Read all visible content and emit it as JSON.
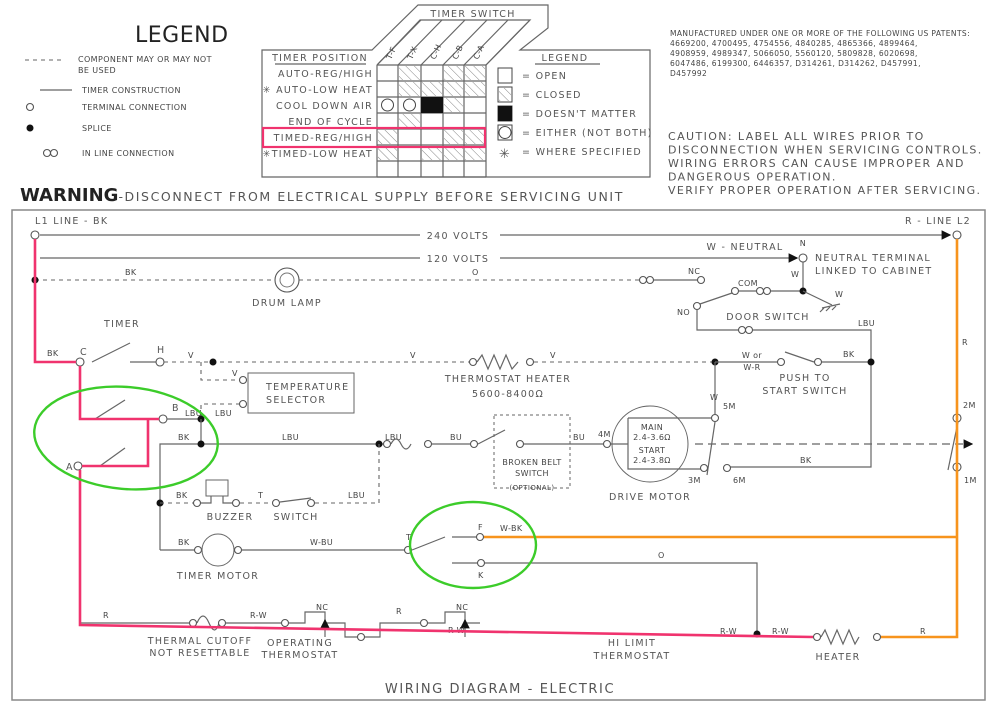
{
  "legend_left": {
    "title": "LEGEND",
    "items": [
      {
        "label": "COMPONENT MAY OR MAY NOT",
        "label2": "BE USED",
        "symbol": "dashed-line"
      },
      {
        "label": "TIMER CONSTRUCTION",
        "symbol": "solid-line"
      },
      {
        "label": "TERMINAL CONNECTION",
        "symbol": "open-circle"
      },
      {
        "label": "SPLICE",
        "symbol": "filled-dot"
      },
      {
        "label": "IN LINE CONNECTION",
        "symbol": "double-circle"
      }
    ]
  },
  "timer_chart": {
    "title": "TIMER SWITCH",
    "position_header": "TIMER POSITION",
    "columns": [
      "T-F",
      "T-X",
      "C-H",
      "C-B",
      "C-A"
    ],
    "rows": [
      {
        "label": "AUTO-REG/HIGH",
        "cells": [
          "open",
          "closed",
          "open",
          "closed",
          "closed"
        ]
      },
      {
        "label": "✳ AUTO-LOW HEAT",
        "cells": [
          "open",
          "closed",
          "closed",
          "closed",
          "closed"
        ]
      },
      {
        "label": "COOL DOWN   AIR",
        "cells": [
          "either",
          "either",
          "doesnt-matter",
          "closed",
          "open"
        ]
      },
      {
        "label": "END OF CYCLE",
        "cells": [
          "open",
          "closed",
          "open",
          "open",
          "open"
        ]
      },
      {
        "label": "TIMED-REG/HIGH",
        "cells": [
          "closed",
          "open",
          "open",
          "closed",
          "closed"
        ],
        "highlighted": true
      },
      {
        "label": "✳TIMED-LOW HEAT",
        "cells": [
          "closed",
          "open",
          "closed",
          "closed",
          "closed"
        ]
      }
    ],
    "legend_title": "LEGEND",
    "legend": [
      {
        "symbol": "open",
        "label": "= OPEN"
      },
      {
        "symbol": "closed",
        "label": "= CLOSED"
      },
      {
        "symbol": "doesnt-matter",
        "label": "= DOESN'T MATTER"
      },
      {
        "symbol": "either",
        "label": "= EITHER (NOT BOTH)"
      },
      {
        "symbol": "asterisk",
        "label": "= WHERE SPECIFIED"
      }
    ]
  },
  "patents": [
    "MANUFACTURED UNDER ONE OR MORE OF THE FOLLOWING US PATENTS:",
    "4669200,  4700495,  4754556,  4840285,  4865366,  4899464,",
    "4908959,  4989347,  5066050,  5560120,  5809828,  6020698,",
    "6047486,  6199300,  6446357,  D314261,  D314262,  D457991,",
    "D457992"
  ],
  "caution": [
    "CAUTION: LABEL ALL WIRES PRIOR TO",
    "DISCONNECTION WHEN SERVICING CONTROLS.",
    "WIRING ERRORS CAN CAUSE IMPROPER AND",
    "DANGEROUS OPERATION.",
    "VERIFY PROPER OPERATION AFTER SERVICING."
  ],
  "warning": {
    "bold": "WARNING",
    "text": "-DISCONNECT FROM ELECTRICAL SUPPLY BEFORE SERVICING UNIT"
  },
  "diagram": {
    "title": "WIRING DIAGRAM - ELECTRIC",
    "l1": "L1 LINE - BK",
    "l2": "R - LINE L2",
    "v240": "240 VOLTS",
    "v120": "120 VOLTS",
    "neutral": "W - NEUTRAL",
    "n": "N",
    "neutral_terminal": [
      "NEUTRAL TERMINAL",
      "LINKED TO CABINET"
    ],
    "drum_lamp": "DRUM LAMP",
    "door_switch": "DOOR SWITCH",
    "timer": "TIMER",
    "temperature_selector": [
      "TEMPERATURE",
      "SELECTOR"
    ],
    "thermostat_heater": [
      "THERMOSTAT HEATER",
      "5600-8400Ω"
    ],
    "push_to_start": [
      "PUSH TO",
      "START SWITCH"
    ],
    "w_or_wr": [
      "W or",
      "W-R"
    ],
    "broken_belt": [
      "BROKEN BELT",
      "SWITCH",
      "(OPTIONAL)"
    ],
    "drive_motor": "DRIVE MOTOR",
    "motor_main": [
      "MAIN",
      "2.4-3.6Ω"
    ],
    "motor_start": [
      "START",
      "2.4-3.8Ω"
    ],
    "buzzer": "BUZZER",
    "switch": "SWITCH",
    "timer_motor": "TIMER MOTOR",
    "thermal_cutoff": [
      "THERMAL CUTOFF",
      "NOT RESETTABLE"
    ],
    "operating_thermostat": [
      "OPERATING",
      "THERMOSTAT"
    ],
    "hi_limit": [
      "HI LIMIT",
      "THERMOSTAT"
    ],
    "heater": "HEATER",
    "terminals": {
      "C": "C",
      "H": "H",
      "B": "B",
      "A": "A",
      "T": "T",
      "F": "F",
      "K": "K",
      "NC": "NC",
      "NO": "NO",
      "COM": "COM",
      "m5": "5M",
      "m4": "4M",
      "m3": "3M",
      "m6": "6M",
      "m2": "2M",
      "m1": "1M"
    },
    "wires": {
      "BK": "BK",
      "O": "O",
      "W": "W",
      "V": "V",
      "LBU": "LBU",
      "BU": "BU",
      "R": "R",
      "RW": "R-W",
      "WBU": "W-BU",
      "WBK": "W-BK",
      "T": "T"
    }
  },
  "colors": {
    "highlight_pink": "#f0336e",
    "highlight_orange": "#f7941d",
    "circle_green": "#3ccc2a"
  }
}
